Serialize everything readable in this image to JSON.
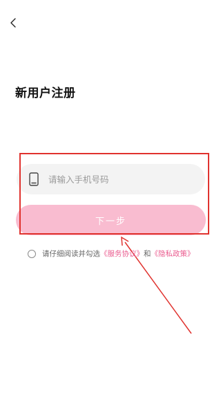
{
  "header": {
    "back_icon": "chevron-left-icon"
  },
  "title": "新用户注册",
  "phone_field": {
    "icon": "mobile-phone-icon",
    "placeholder": "请输入手机号码",
    "value": ""
  },
  "next_button": {
    "label": "下一步"
  },
  "agreement": {
    "prefix": "请仔细阅读并勾选",
    "service_link": "《服务协议》",
    "conjunction": "和",
    "privacy_link": "《隐私政策》",
    "checked": false
  },
  "colors": {
    "accent_pink": "#f9bcd0",
    "link_pink": "#ea5c8f",
    "annotation_red": "#e0322e",
    "field_bg": "#f3f3f3"
  }
}
